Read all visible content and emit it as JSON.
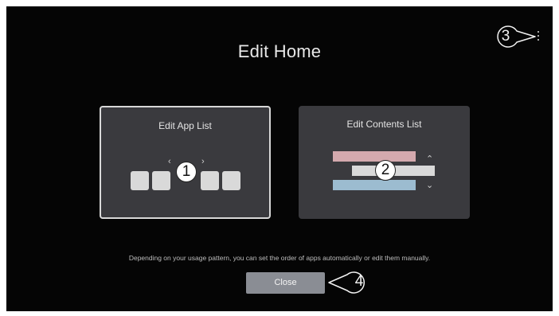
{
  "header": {
    "title": "Edit Home"
  },
  "menu": {
    "icon": "kebab-menu-icon",
    "callout_number": "3"
  },
  "cards": [
    {
      "title": "Edit App List",
      "marker": "1"
    },
    {
      "title": "Edit Contents List",
      "marker": "2"
    }
  ],
  "description": "Depending on your usage pattern, you can set the order of apps automatically or edit them manually.",
  "close": {
    "label": "Close",
    "callout_number": "4"
  },
  "colors": {
    "background": "#050505",
    "card": "#3a3a3e",
    "focus_border": "#d8d8d8",
    "button": "#8a8d94",
    "pink_row": "#d4a9ae",
    "blue_row": "#9cbcd0"
  }
}
